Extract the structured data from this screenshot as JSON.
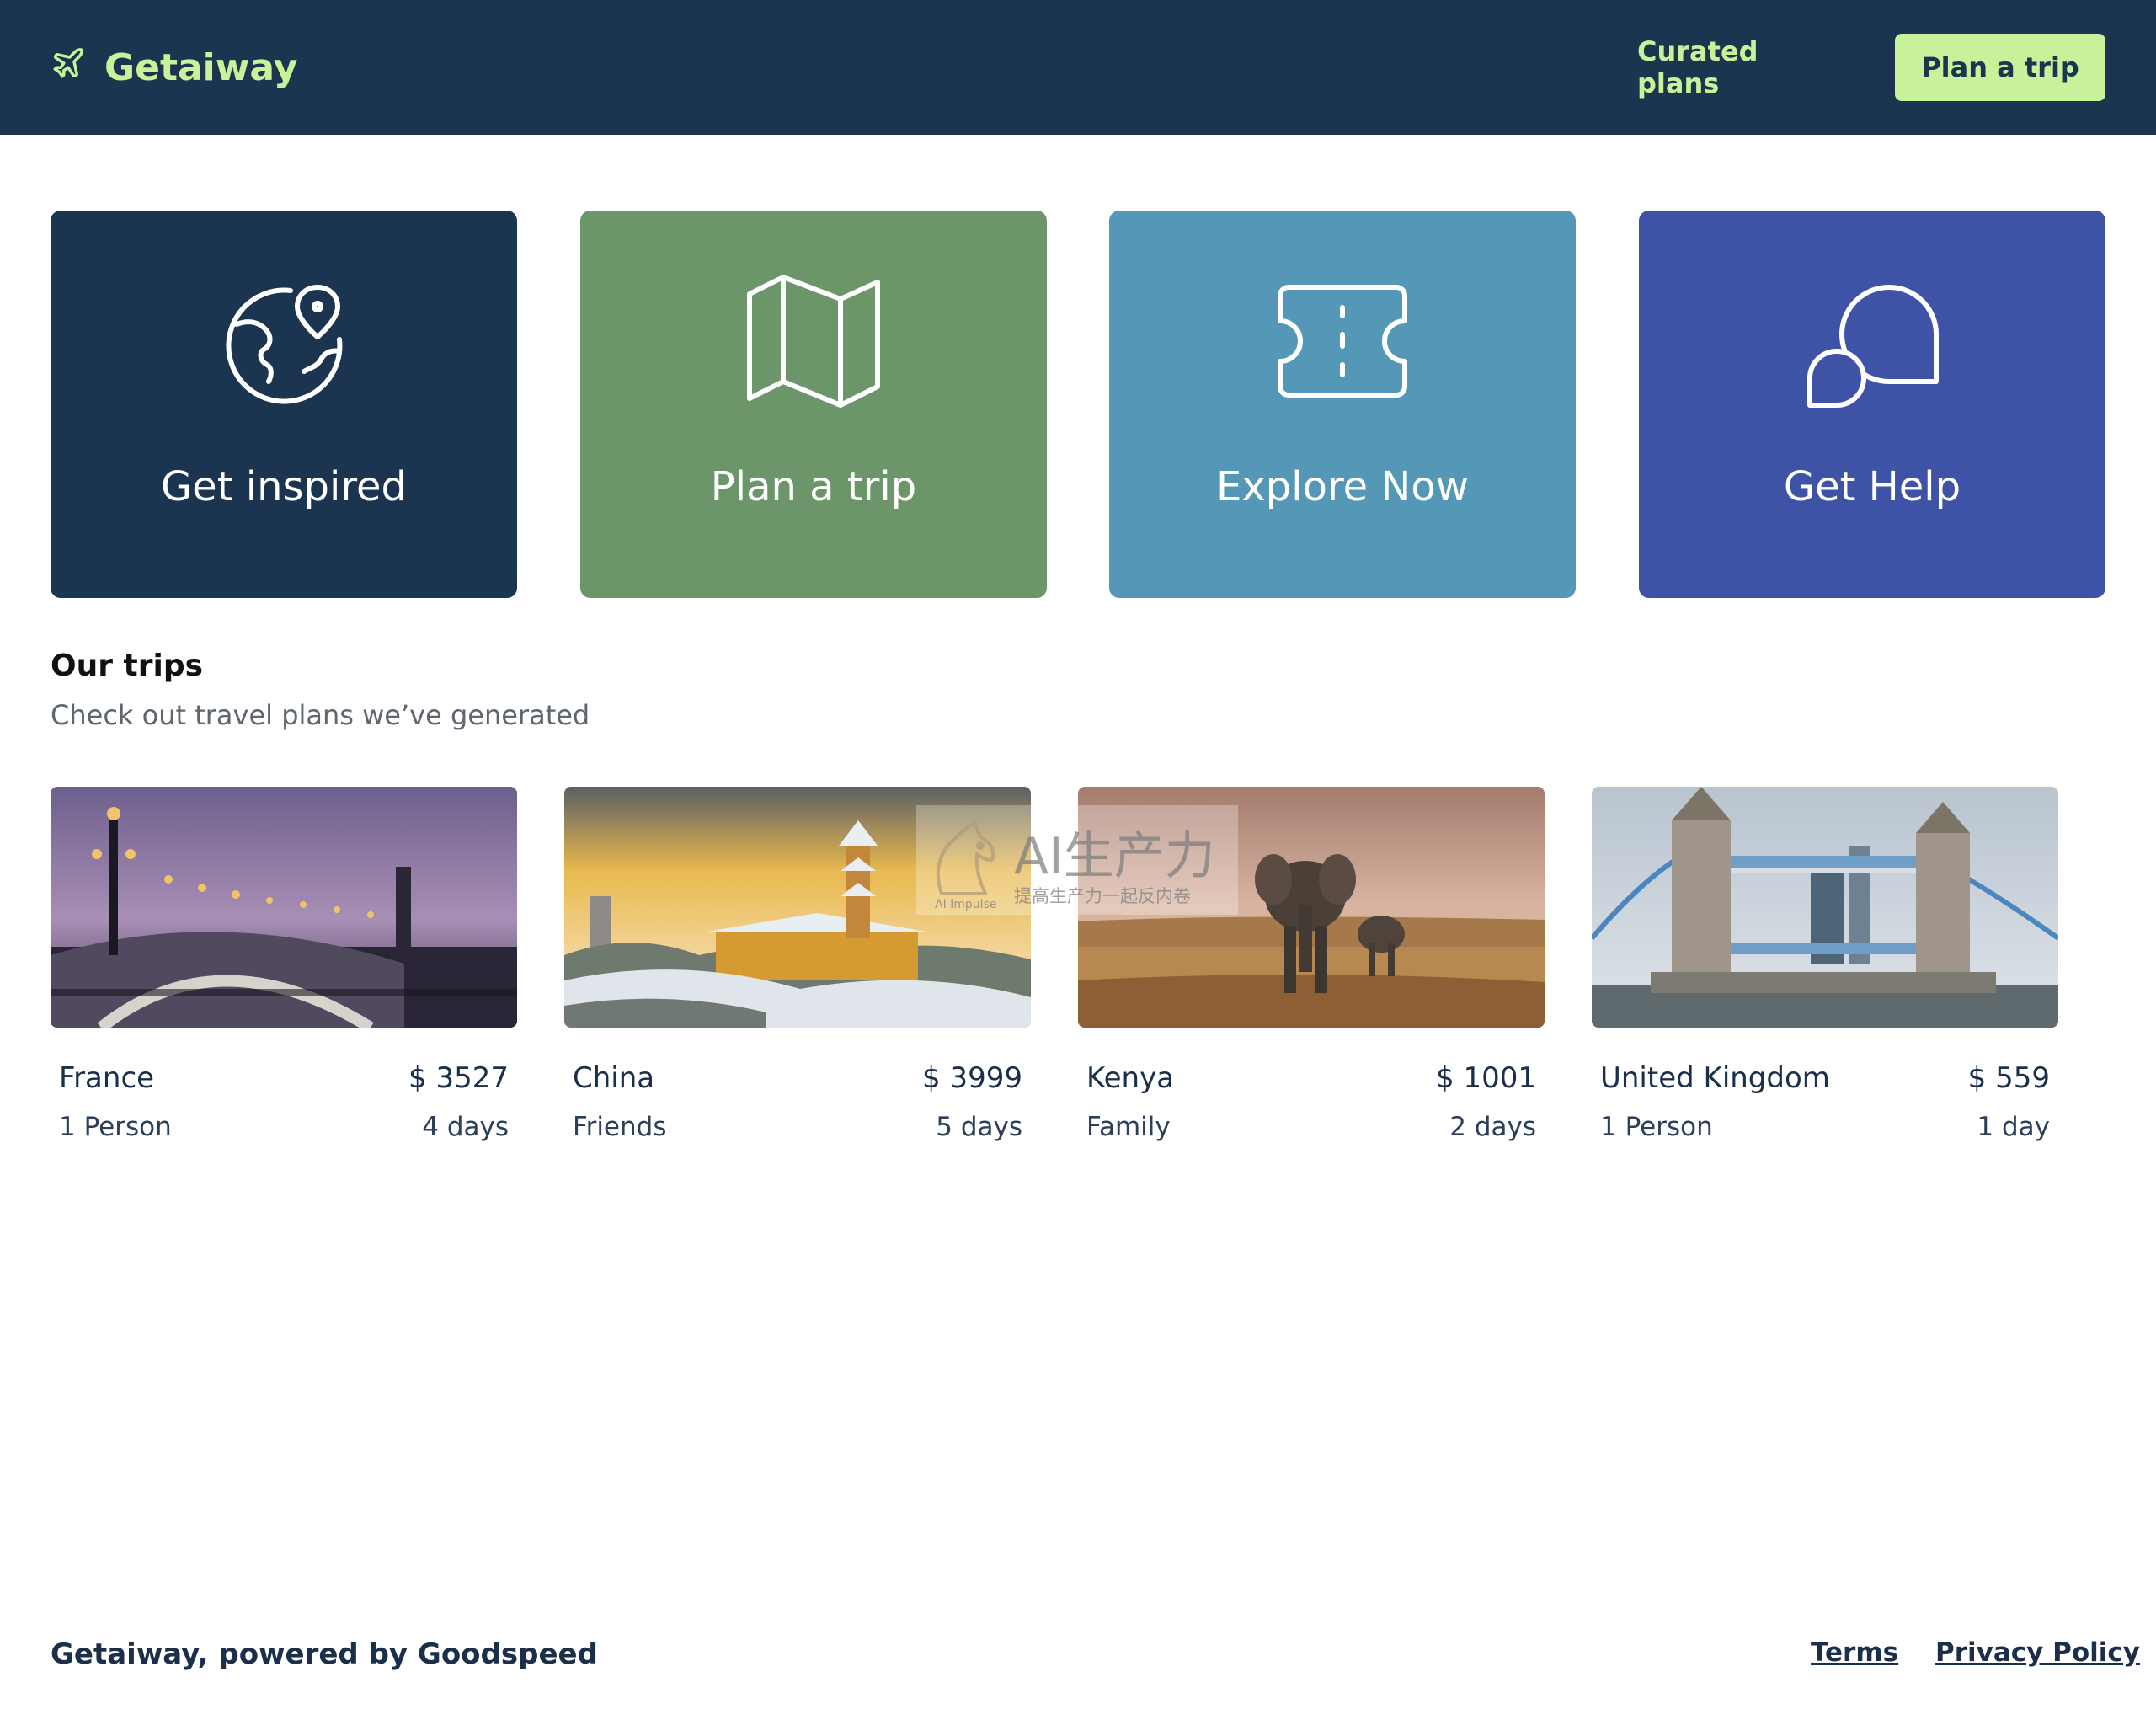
{
  "header": {
    "brand": "Getaiway",
    "brand_icon": "airplane-icon",
    "nav_link": "Curated plans",
    "nav_cta": "Plan a trip",
    "colors": {
      "background": "#1b3450",
      "accent": "#c7f29a"
    }
  },
  "actions": [
    {
      "label": "Get inspired",
      "icon": "globe-pin-icon",
      "color": "#1b3450"
    },
    {
      "label": "Plan a trip",
      "icon": "map-icon",
      "color": "#6c966a"
    },
    {
      "label": "Explore Now",
      "icon": "ticket-icon",
      "color": "#5597b6"
    },
    {
      "label": "Get Help",
      "icon": "chat-bubbles-icon",
      "color": "#3f53a6"
    }
  ],
  "trips_section": {
    "title": "Our trips",
    "subtitle": "Check out travel plans we’ve generated"
  },
  "trips": [
    {
      "name": "France",
      "price": "$ 3527",
      "group": "1 Person",
      "duration": "4 days"
    },
    {
      "name": "China",
      "price": "$ 3999",
      "group": "Friends",
      "duration": "5 days"
    },
    {
      "name": "Kenya",
      "price": "$ 1001",
      "group": "Family",
      "duration": "2 days"
    },
    {
      "name": "United Kingdom",
      "price": "$ 559",
      "group": "1 Person",
      "duration": "1 day"
    }
  ],
  "watermark": {
    "big": "AI生产力",
    "small": "提高生产力一起反内卷",
    "tiny": "AI Impulse"
  },
  "footer": {
    "brand": "Getaiway, powered by Goodspeed",
    "terms": "Terms",
    "privacy": "Privacy Policy"
  }
}
